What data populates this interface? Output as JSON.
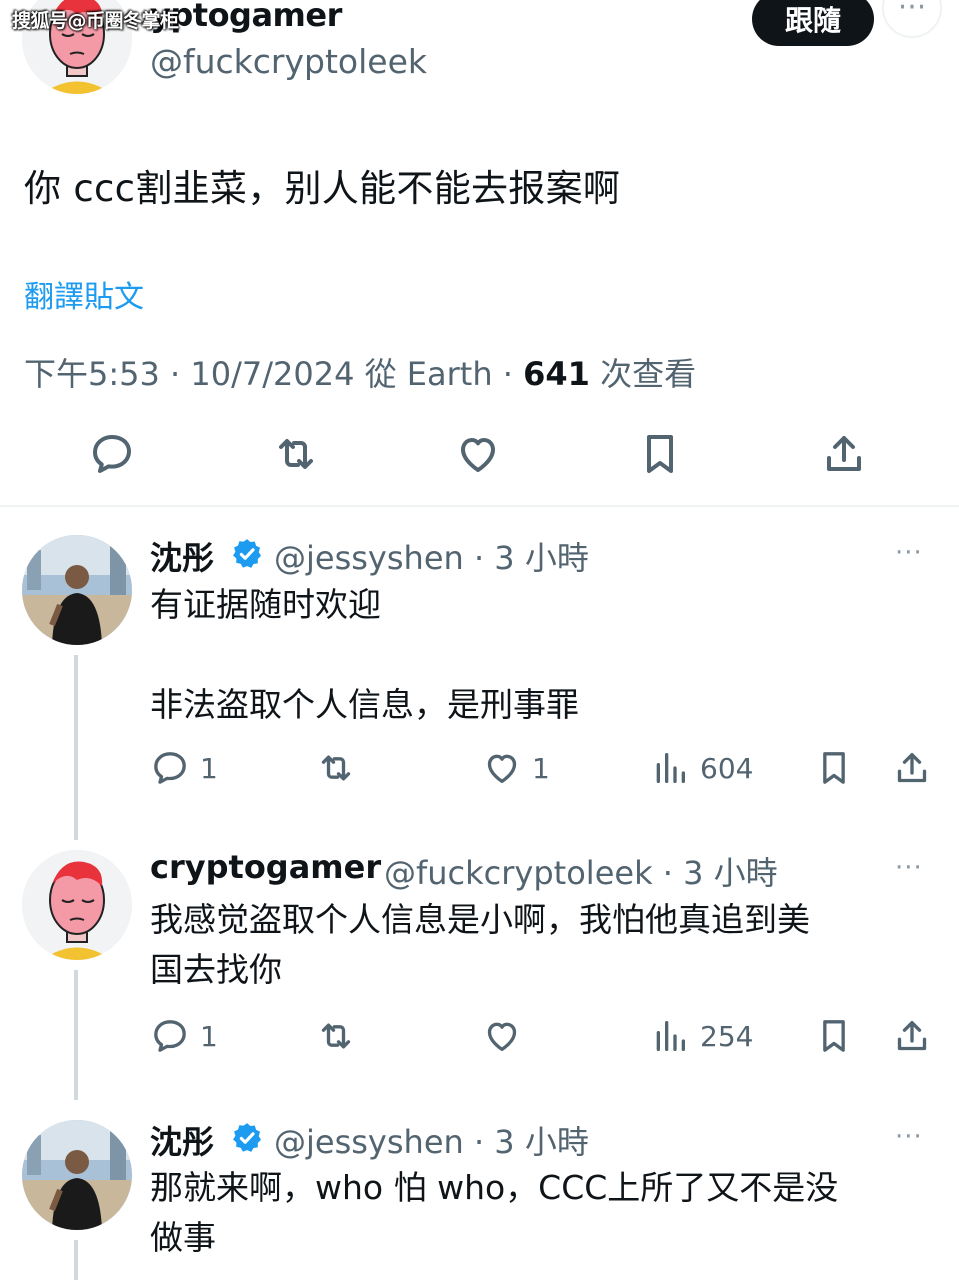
{
  "watermark": "搜狐号@币圈冬掌柜",
  "tweet": {
    "author_name": "cryptogamer",
    "author_name_visible": "yptogamer",
    "author_handle": "@fuckcryptoleek",
    "follow_label": "跟隨",
    "more_label": "···",
    "text": "你 ccc割韭菜，别人能不能去报案啊",
    "translate_label": "翻譯貼文",
    "meta_prefix": "下午5:53 · 10/7/2024 從 Earth · ",
    "views": "641",
    "views_suffix": " 次查看",
    "actions": [
      "reply-icon",
      "retweet-icon",
      "like-icon",
      "bookmark-icon",
      "share-icon"
    ]
  },
  "replies": [
    {
      "name": "沈彤",
      "verified": true,
      "handle_time": "@jessyshen · 3 小時",
      "text": "有证据随时欢迎\n\n非法盗取个人信息，是刑事罪",
      "reply_count": "1",
      "retweet_count": "",
      "like_count": "1",
      "view_count": "604",
      "more": "···"
    },
    {
      "name": "cryptogamer",
      "verified": false,
      "handle_time": "@fuckcryptoleek · 3 小時",
      "text": "我感觉盗取个人信息是小啊，我怕他真追到美\n国去找你",
      "reply_count": "1",
      "retweet_count": "",
      "like_count": "",
      "view_count": "254",
      "more": "···"
    },
    {
      "name": "沈彤",
      "verified": true,
      "handle_time": "@jessyshen · 3 小時",
      "text": "那就来啊，who 怕 who，CCC上所了又不是没\n做事",
      "more": "···"
    }
  ],
  "colors": {
    "text": "#0f1419",
    "secondary": "#536471",
    "link": "#1d9bf0",
    "verified": "#1d9bf0",
    "follow_bg": "#0f1419"
  }
}
